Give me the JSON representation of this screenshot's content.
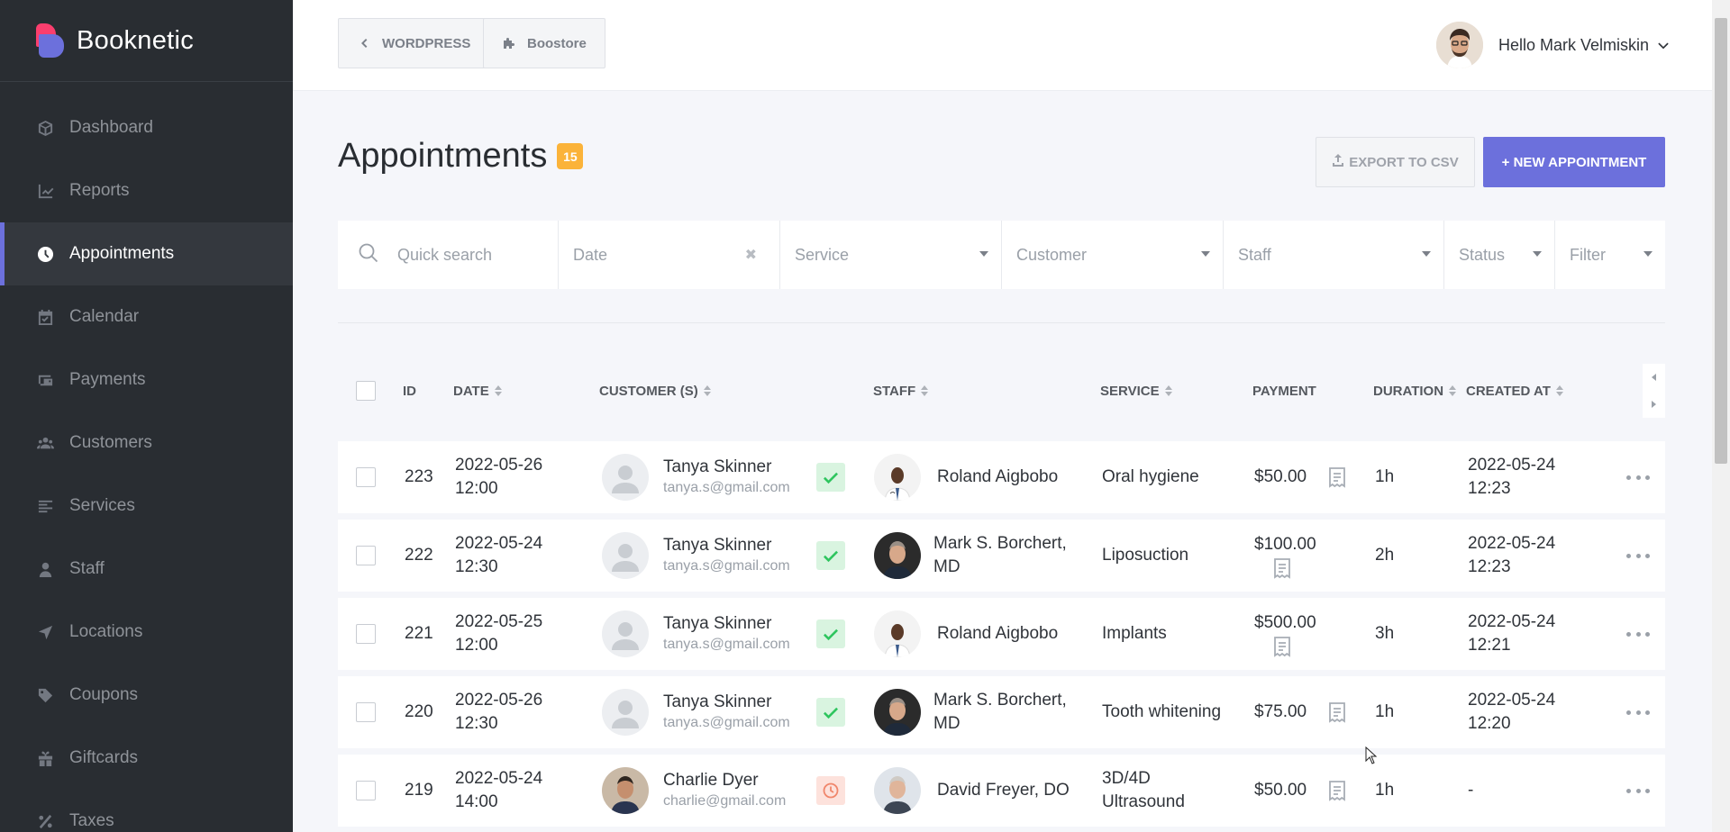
{
  "app": {
    "name": "Booknetic"
  },
  "sidebar": {
    "items": [
      {
        "label": "Dashboard",
        "icon": "dashboard-icon"
      },
      {
        "label": "Reports",
        "icon": "chart-icon"
      },
      {
        "label": "Appointments",
        "icon": "clock-icon",
        "active": true
      },
      {
        "label": "Calendar",
        "icon": "calendar-icon"
      },
      {
        "label": "Payments",
        "icon": "wallet-icon"
      },
      {
        "label": "Customers",
        "icon": "users-icon"
      },
      {
        "label": "Services",
        "icon": "list-icon"
      },
      {
        "label": "Staff",
        "icon": "user-icon"
      },
      {
        "label": "Locations",
        "icon": "location-arrow-icon"
      },
      {
        "label": "Coupons",
        "icon": "tag-icon"
      },
      {
        "label": "Giftcards",
        "icon": "gift-icon"
      },
      {
        "label": "Taxes",
        "icon": "percent-icon"
      }
    ]
  },
  "topbar": {
    "wordpress_label": "WORDPRESS",
    "boostore_label": "Boostore",
    "greeting": "Hello Mark Velmiskin"
  },
  "page": {
    "title": "Appointments",
    "count": "15",
    "export_label": "EXPORT TO CSV",
    "new_label": "+ NEW APPOINTMENT"
  },
  "filters": {
    "search_placeholder": "Quick search",
    "date": "Date",
    "service": "Service",
    "customer": "Customer",
    "staff": "Staff",
    "status": "Status",
    "filter": "Filter"
  },
  "table": {
    "headers": {
      "id": "ID",
      "date": "DATE",
      "customers": "CUSTOMER (S)",
      "staff": "STAFF",
      "service": "SERVICE",
      "payment": "PAYMENT",
      "duration": "DURATION",
      "created_at": "CREATED AT"
    },
    "rows": [
      {
        "id": "223",
        "date1": "2022-05-26",
        "date2": "12:00",
        "customer": "Tanya Skinner",
        "email": "tanya.s@gmail.com",
        "status": "approved",
        "staff1": "Roland Aigbobo",
        "staff2": "",
        "service1": "Oral hygiene",
        "service2": "",
        "payment": "$50.00",
        "duration": "1h",
        "created1": "2022-05-24",
        "created2": "12:23"
      },
      {
        "id": "222",
        "date1": "2022-05-24",
        "date2": "12:30",
        "customer": "Tanya Skinner",
        "email": "tanya.s@gmail.com",
        "status": "approved",
        "staff1": "Mark S. Borchert,",
        "staff2": "MD",
        "service1": "Liposuction",
        "service2": "",
        "payment": "$100.00",
        "duration": "2h",
        "created1": "2022-05-24",
        "created2": "12:23"
      },
      {
        "id": "221",
        "date1": "2022-05-25",
        "date2": "12:00",
        "customer": "Tanya Skinner",
        "email": "tanya.s@gmail.com",
        "status": "approved",
        "staff1": "Roland Aigbobo",
        "staff2": "",
        "service1": "Implants",
        "service2": "",
        "payment": "$500.00",
        "duration": "3h",
        "created1": "2022-05-24",
        "created2": "12:21"
      },
      {
        "id": "220",
        "date1": "2022-05-26",
        "date2": "12:30",
        "customer": "Tanya Skinner",
        "email": "tanya.s@gmail.com",
        "status": "approved",
        "staff1": "Mark S. Borchert,",
        "staff2": "MD",
        "service1": "Tooth whitening",
        "service2": "",
        "payment": "$75.00",
        "duration": "1h",
        "created1": "2022-05-24",
        "created2": "12:20"
      },
      {
        "id": "219",
        "date1": "2022-05-24",
        "date2": "14:00",
        "customer": "Charlie Dyer",
        "email": "charlie@gmail.com",
        "status": "pending",
        "staff1": "David Freyer, DO",
        "staff2": "",
        "service1": "3D/4D",
        "service2": "Ultrasound",
        "payment": "$50.00",
        "duration": "1h",
        "created1": "-",
        "created2": ""
      }
    ]
  },
  "colors": {
    "accent": "#6c70dc",
    "sidebar": "#292d32",
    "badge": "#fbb339",
    "approved": "#2ec55e",
    "pending": "#f0866b"
  }
}
